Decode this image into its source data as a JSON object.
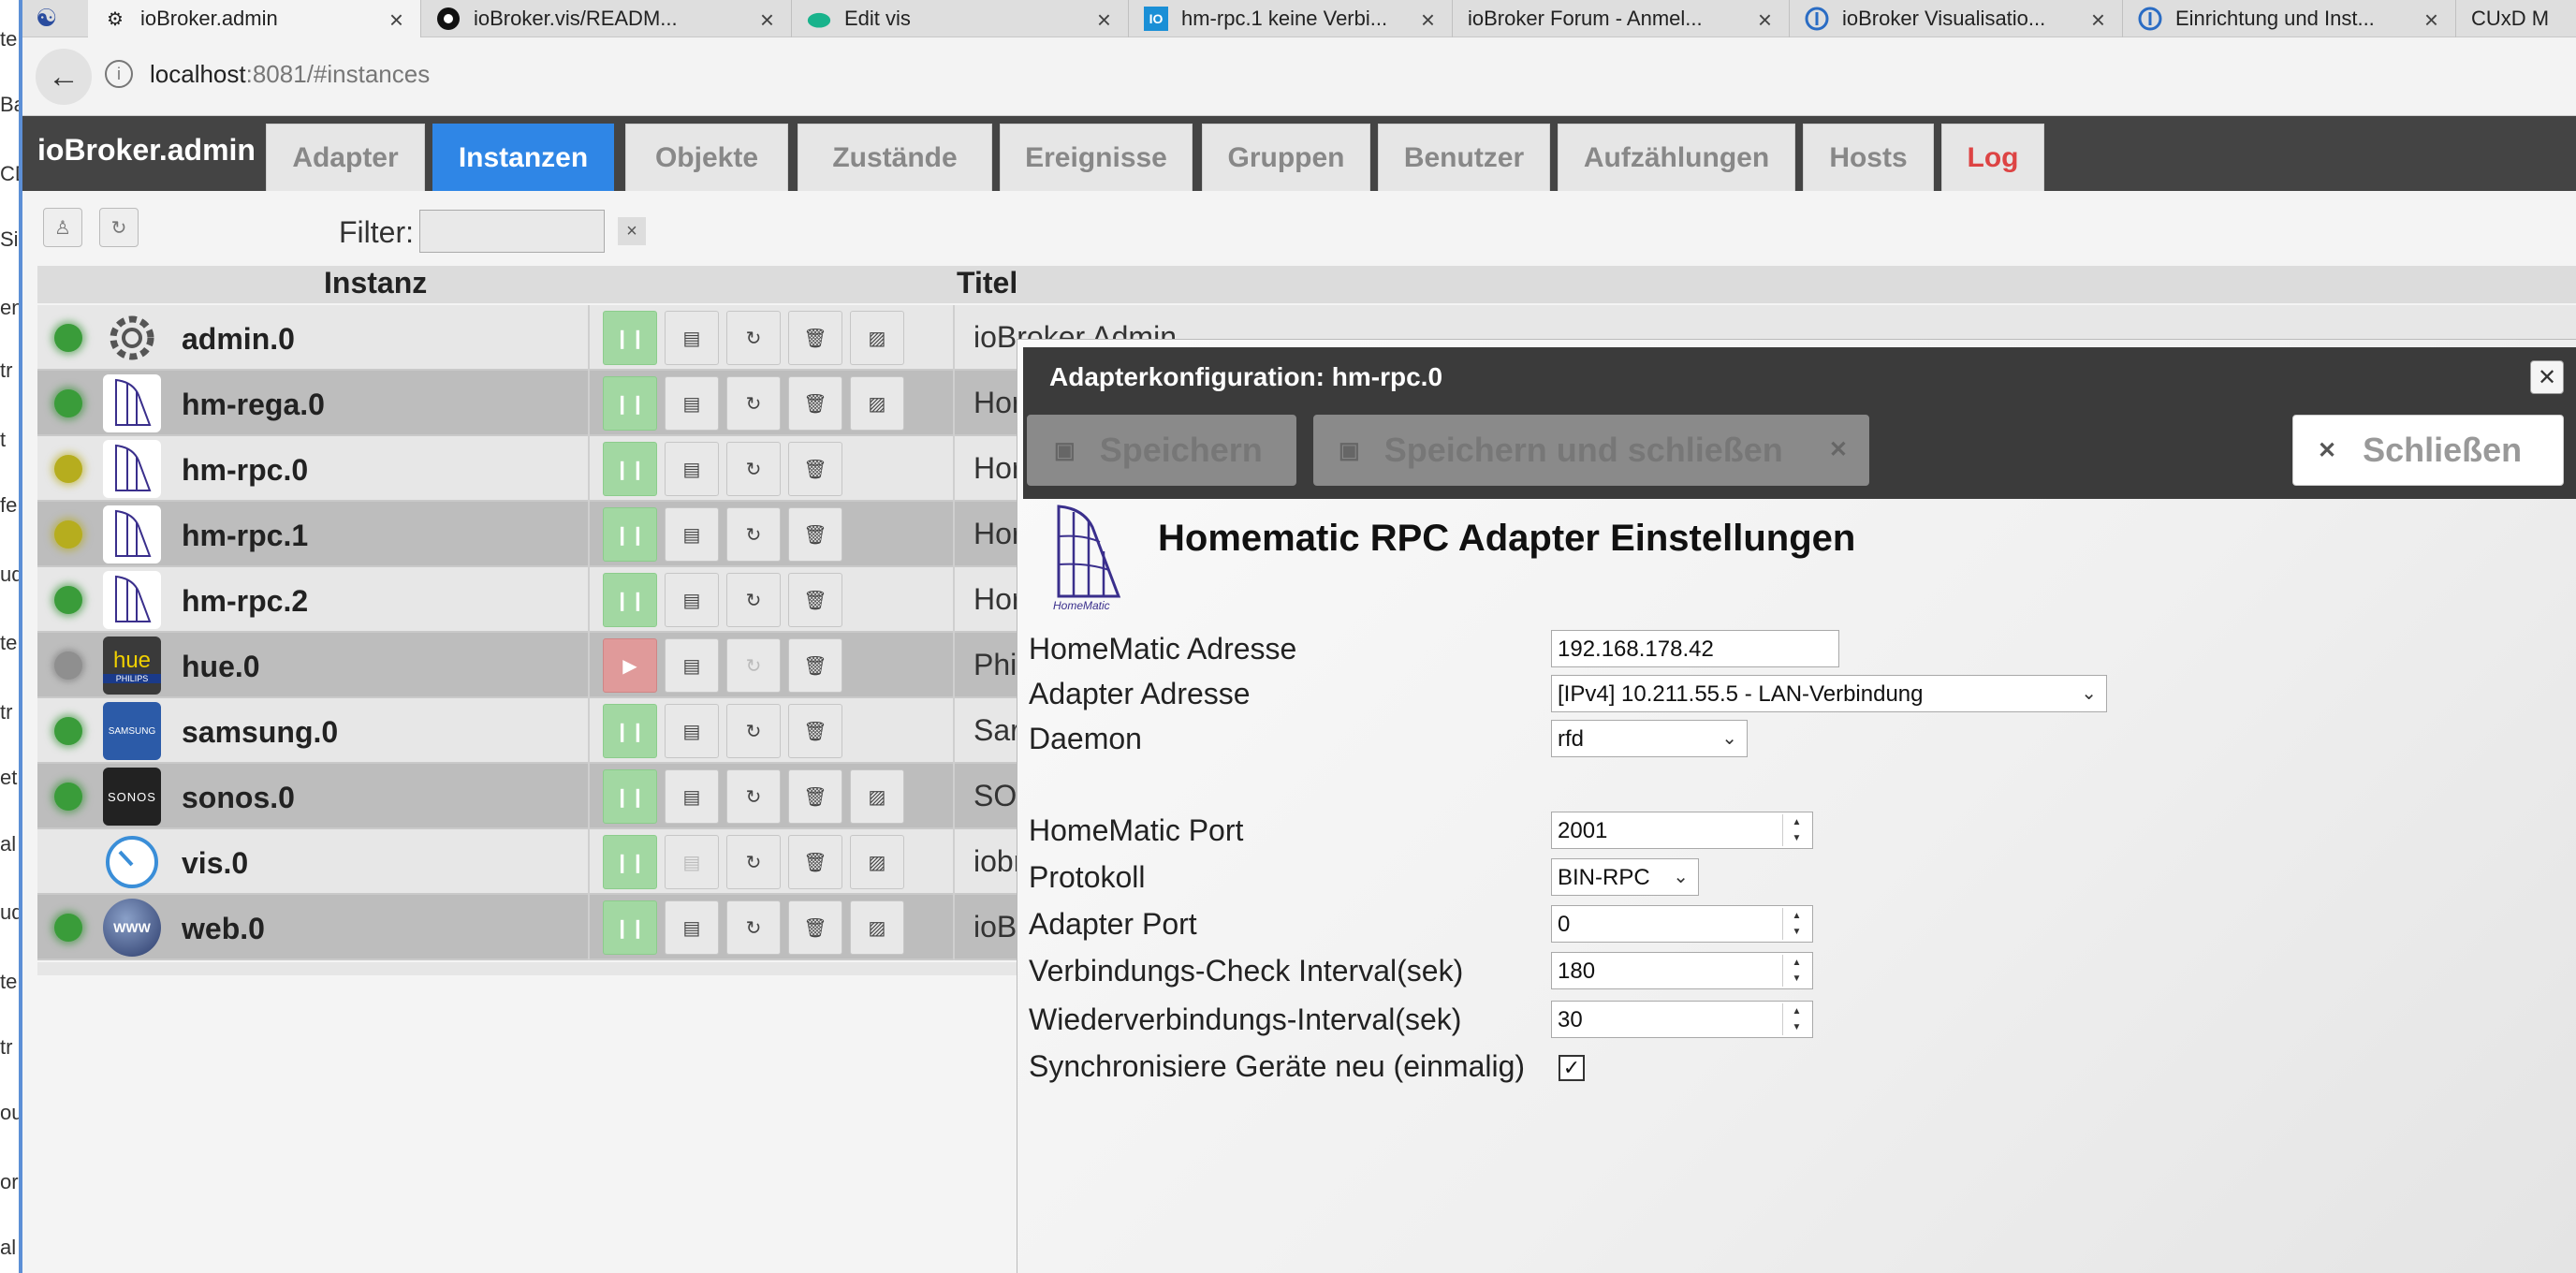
{
  "browser": {
    "tabs": [
      {
        "label": "ioBroker.admin",
        "icon": "gear-icon",
        "active": true
      },
      {
        "label": "ioBroker.vis/READM...",
        "icon": "github-icon"
      },
      {
        "label": "Edit vis",
        "icon": "green-cloud-icon"
      },
      {
        "label": "hm-rpc.1 keine Verbi...",
        "icon": "io-icon"
      },
      {
        "label": "ioBroker Forum - Anmel...",
        "icon": ""
      },
      {
        "label": "ioBroker Visualisatio...",
        "icon": "iobroker-icon"
      },
      {
        "label": "Einrichtung und Inst...",
        "icon": "iobroker-icon"
      },
      {
        "label": "CUxD M",
        "icon": ""
      }
    ],
    "url_host": "localhost",
    "url_path": ":8081/#instances"
  },
  "left_strip": [
    "te",
    "Ba",
    "CD",
    "Sic",
    "en",
    "tr",
    "t",
    "fe",
    "ud",
    "te",
    "tr",
    "et",
    "al",
    "ud",
    "te",
    "tr",
    "ou",
    "or",
    "al"
  ],
  "app": {
    "title": "ioBroker.admin",
    "nav": [
      "Adapter",
      "Instanzen",
      "Objekte",
      "Zustände",
      "Ereignisse",
      "Gruppen",
      "Benutzer",
      "Aufzählungen",
      "Hosts",
      "Log"
    ],
    "active_nav": "Instanzen"
  },
  "toolbar": {
    "filter_label": "Filter:",
    "filter_value": "",
    "clear_icon": "×"
  },
  "grid": {
    "headers": {
      "instance": "Instanz",
      "title": "Titel"
    },
    "rows": [
      {
        "name": "admin.0",
        "status": "green",
        "icon": "gear-icon",
        "state": "running",
        "titletext": "ioBroker Admin"
      },
      {
        "name": "hm-rega.0",
        "status": "green",
        "icon": "homematic-icon",
        "state": "running",
        "titletext": "Hor"
      },
      {
        "name": "hm-rpc.0",
        "status": "yellow",
        "icon": "homematic-icon",
        "state": "running",
        "titletext": "Hor"
      },
      {
        "name": "hm-rpc.1",
        "status": "yellow",
        "icon": "homematic-icon",
        "state": "running",
        "titletext": "Hor"
      },
      {
        "name": "hm-rpc.2",
        "status": "green",
        "icon": "homematic-icon",
        "state": "running",
        "titletext": "Hor"
      },
      {
        "name": "hue.0",
        "status": "grey",
        "icon": "hue-icon",
        "state": "stopped",
        "titletext": "Phil"
      },
      {
        "name": "samsung.0",
        "status": "green",
        "icon": "samsung-icon",
        "state": "running",
        "titletext": "Sar"
      },
      {
        "name": "sonos.0",
        "status": "green",
        "icon": "sonos-icon",
        "state": "running",
        "titletext": "SOI"
      },
      {
        "name": "vis.0",
        "status": "none",
        "icon": "gauge-icon",
        "state": "running",
        "titletext": "iobr"
      },
      {
        "name": "web.0",
        "status": "green",
        "icon": "globe-icon",
        "state": "running",
        "titletext": "ioB"
      }
    ],
    "icon_texts": {
      "hue": "hue",
      "hue_sub": "PHILIPS",
      "samsung": "SAMSUNG",
      "sonos": "SONOS",
      "web": "WWW",
      "homematic": "HomeMatic"
    }
  },
  "dialog": {
    "title": "Adapterkonfiguration: hm-rpc.0",
    "save": "Speichern",
    "save_close": "Speichern und schließen",
    "close": "Schließen",
    "heading": "Homematic RPC Adapter Einstellungen",
    "logo_text": "HomeMatic",
    "fields": {
      "hm_address_label": "HomeMatic Adresse",
      "hm_address": "192.168.178.42",
      "adapter_address_label": "Adapter Adresse",
      "adapter_address": "[IPv4] 10.211.55.5 - LAN-Verbindung",
      "daemon_label": "Daemon",
      "daemon": "rfd",
      "hm_port_label": "HomeMatic Port",
      "hm_port": "2001",
      "protocol_label": "Protokoll",
      "protocol": "BIN-RPC",
      "adapter_port_label": "Adapter Port",
      "adapter_port": "0",
      "check_interval_label": "Verbindungs-Check Interval(sek)",
      "check_interval": "180",
      "reconnect_interval_label": "Wiederverbindungs-Interval(sek)",
      "reconnect_interval": "30",
      "sync_label": "Synchronisiere Geräte neu (einmalig)",
      "sync_checked": true
    }
  }
}
